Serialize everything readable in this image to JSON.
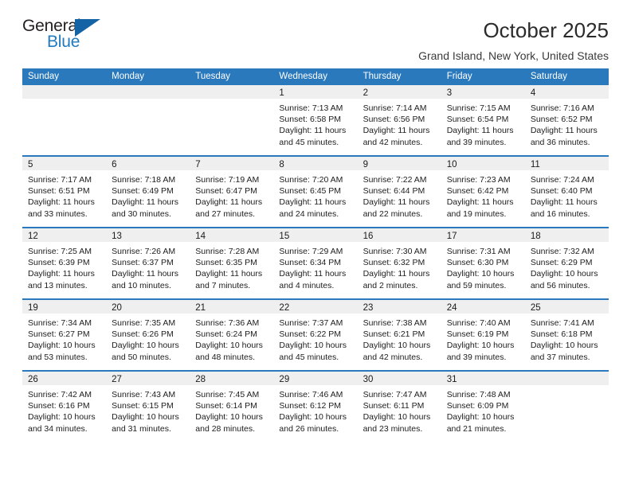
{
  "brand": {
    "name_top": "General",
    "name_bottom": "Blue",
    "accent_color": "#1464a5",
    "blue_text_color": "#1f7ac0",
    "triangle_icon": "triangle-icon"
  },
  "header": {
    "title": "October 2025",
    "subtitle": "Grand Island, New York, United States"
  },
  "calendar": {
    "header_bg": "#2a79bd",
    "daynum_band_bg": "#efefef",
    "weekdays": [
      "Sunday",
      "Monday",
      "Tuesday",
      "Wednesday",
      "Thursday",
      "Friday",
      "Saturday"
    ],
    "weeks": [
      [
        {
          "empty": true
        },
        {
          "empty": true
        },
        {
          "empty": true
        },
        {
          "day": "1",
          "sunrise": "Sunrise: 7:13 AM",
          "sunset": "Sunset: 6:58 PM",
          "daylight": "Daylight: 11 hours and 45 minutes."
        },
        {
          "day": "2",
          "sunrise": "Sunrise: 7:14 AM",
          "sunset": "Sunset: 6:56 PM",
          "daylight": "Daylight: 11 hours and 42 minutes."
        },
        {
          "day": "3",
          "sunrise": "Sunrise: 7:15 AM",
          "sunset": "Sunset: 6:54 PM",
          "daylight": "Daylight: 11 hours and 39 minutes."
        },
        {
          "day": "4",
          "sunrise": "Sunrise: 7:16 AM",
          "sunset": "Sunset: 6:52 PM",
          "daylight": "Daylight: 11 hours and 36 minutes."
        }
      ],
      [
        {
          "day": "5",
          "sunrise": "Sunrise: 7:17 AM",
          "sunset": "Sunset: 6:51 PM",
          "daylight": "Daylight: 11 hours and 33 minutes."
        },
        {
          "day": "6",
          "sunrise": "Sunrise: 7:18 AM",
          "sunset": "Sunset: 6:49 PM",
          "daylight": "Daylight: 11 hours and 30 minutes."
        },
        {
          "day": "7",
          "sunrise": "Sunrise: 7:19 AM",
          "sunset": "Sunset: 6:47 PM",
          "daylight": "Daylight: 11 hours and 27 minutes."
        },
        {
          "day": "8",
          "sunrise": "Sunrise: 7:20 AM",
          "sunset": "Sunset: 6:45 PM",
          "daylight": "Daylight: 11 hours and 24 minutes."
        },
        {
          "day": "9",
          "sunrise": "Sunrise: 7:22 AM",
          "sunset": "Sunset: 6:44 PM",
          "daylight": "Daylight: 11 hours and 22 minutes."
        },
        {
          "day": "10",
          "sunrise": "Sunrise: 7:23 AM",
          "sunset": "Sunset: 6:42 PM",
          "daylight": "Daylight: 11 hours and 19 minutes."
        },
        {
          "day": "11",
          "sunrise": "Sunrise: 7:24 AM",
          "sunset": "Sunset: 6:40 PM",
          "daylight": "Daylight: 11 hours and 16 minutes."
        }
      ],
      [
        {
          "day": "12",
          "sunrise": "Sunrise: 7:25 AM",
          "sunset": "Sunset: 6:39 PM",
          "daylight": "Daylight: 11 hours and 13 minutes."
        },
        {
          "day": "13",
          "sunrise": "Sunrise: 7:26 AM",
          "sunset": "Sunset: 6:37 PM",
          "daylight": "Daylight: 11 hours and 10 minutes."
        },
        {
          "day": "14",
          "sunrise": "Sunrise: 7:28 AM",
          "sunset": "Sunset: 6:35 PM",
          "daylight": "Daylight: 11 hours and 7 minutes."
        },
        {
          "day": "15",
          "sunrise": "Sunrise: 7:29 AM",
          "sunset": "Sunset: 6:34 PM",
          "daylight": "Daylight: 11 hours and 4 minutes."
        },
        {
          "day": "16",
          "sunrise": "Sunrise: 7:30 AM",
          "sunset": "Sunset: 6:32 PM",
          "daylight": "Daylight: 11 hours and 2 minutes."
        },
        {
          "day": "17",
          "sunrise": "Sunrise: 7:31 AM",
          "sunset": "Sunset: 6:30 PM",
          "daylight": "Daylight: 10 hours and 59 minutes."
        },
        {
          "day": "18",
          "sunrise": "Sunrise: 7:32 AM",
          "sunset": "Sunset: 6:29 PM",
          "daylight": "Daylight: 10 hours and 56 minutes."
        }
      ],
      [
        {
          "day": "19",
          "sunrise": "Sunrise: 7:34 AM",
          "sunset": "Sunset: 6:27 PM",
          "daylight": "Daylight: 10 hours and 53 minutes."
        },
        {
          "day": "20",
          "sunrise": "Sunrise: 7:35 AM",
          "sunset": "Sunset: 6:26 PM",
          "daylight": "Daylight: 10 hours and 50 minutes."
        },
        {
          "day": "21",
          "sunrise": "Sunrise: 7:36 AM",
          "sunset": "Sunset: 6:24 PM",
          "daylight": "Daylight: 10 hours and 48 minutes."
        },
        {
          "day": "22",
          "sunrise": "Sunrise: 7:37 AM",
          "sunset": "Sunset: 6:22 PM",
          "daylight": "Daylight: 10 hours and 45 minutes."
        },
        {
          "day": "23",
          "sunrise": "Sunrise: 7:38 AM",
          "sunset": "Sunset: 6:21 PM",
          "daylight": "Daylight: 10 hours and 42 minutes."
        },
        {
          "day": "24",
          "sunrise": "Sunrise: 7:40 AM",
          "sunset": "Sunset: 6:19 PM",
          "daylight": "Daylight: 10 hours and 39 minutes."
        },
        {
          "day": "25",
          "sunrise": "Sunrise: 7:41 AM",
          "sunset": "Sunset: 6:18 PM",
          "daylight": "Daylight: 10 hours and 37 minutes."
        }
      ],
      [
        {
          "day": "26",
          "sunrise": "Sunrise: 7:42 AM",
          "sunset": "Sunset: 6:16 PM",
          "daylight": "Daylight: 10 hours and 34 minutes."
        },
        {
          "day": "27",
          "sunrise": "Sunrise: 7:43 AM",
          "sunset": "Sunset: 6:15 PM",
          "daylight": "Daylight: 10 hours and 31 minutes."
        },
        {
          "day": "28",
          "sunrise": "Sunrise: 7:45 AM",
          "sunset": "Sunset: 6:14 PM",
          "daylight": "Daylight: 10 hours and 28 minutes."
        },
        {
          "day": "29",
          "sunrise": "Sunrise: 7:46 AM",
          "sunset": "Sunset: 6:12 PM",
          "daylight": "Daylight: 10 hours and 26 minutes."
        },
        {
          "day": "30",
          "sunrise": "Sunrise: 7:47 AM",
          "sunset": "Sunset: 6:11 PM",
          "daylight": "Daylight: 10 hours and 23 minutes."
        },
        {
          "day": "31",
          "sunrise": "Sunrise: 7:48 AM",
          "sunset": "Sunset: 6:09 PM",
          "daylight": "Daylight: 10 hours and 21 minutes."
        },
        {
          "empty": true
        }
      ]
    ]
  }
}
